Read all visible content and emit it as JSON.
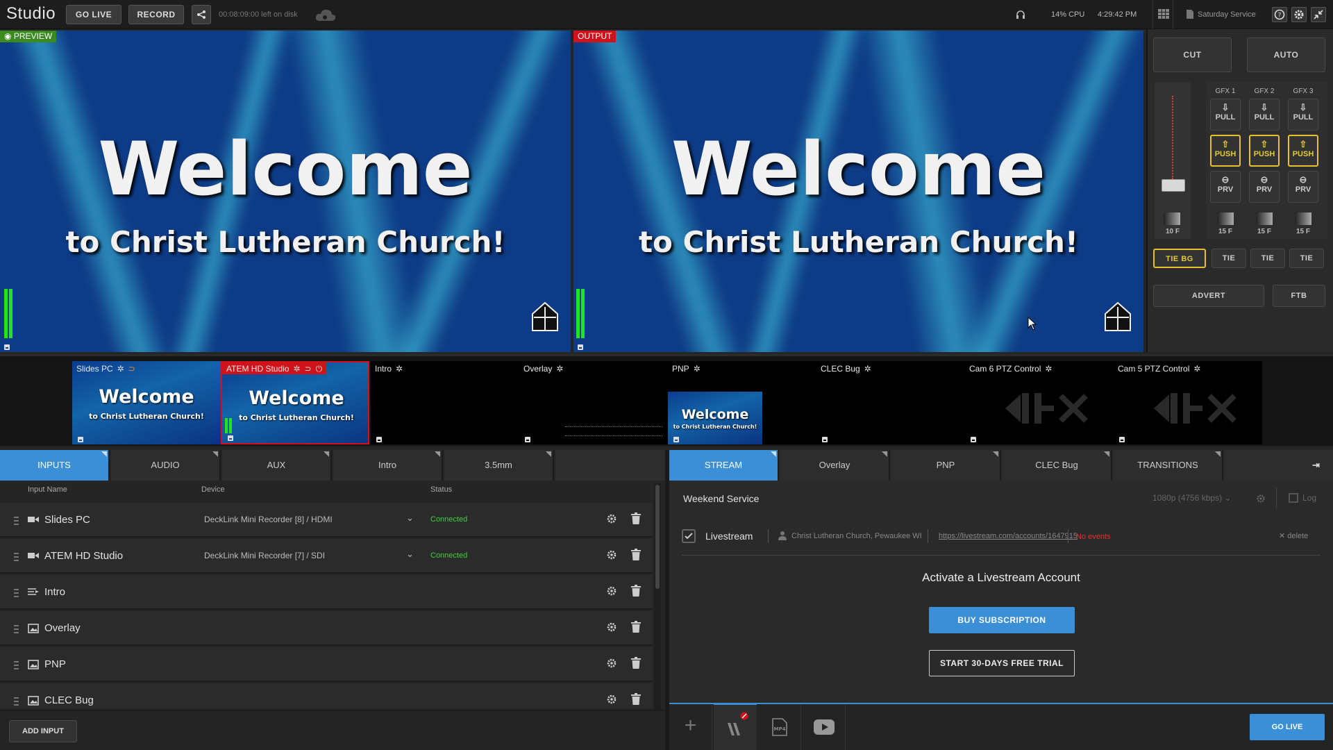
{
  "topbar": {
    "app_title": "Studio",
    "go_live": "GO LIVE",
    "record": "RECORD",
    "disk_left": "00:08:09:00 left on disk",
    "cpu": "14% CPU",
    "clock": "4:29:42 PM",
    "project": "Saturday Service"
  },
  "preview": {
    "badge": "PREVIEW",
    "line1": "Welcome",
    "line2": "to Christ Lutheran Church!",
    "audio_level": 0.55
  },
  "output": {
    "badge": "OUTPUT",
    "line1": "Welcome",
    "line2": "to Christ Lutheran Church!",
    "audio_level": 0.55
  },
  "controls": {
    "cut": "CUT",
    "auto": "AUTO",
    "gfx_headers": [
      "GFX 1",
      "GFX 2",
      "GFX 3"
    ],
    "pull": "PULL",
    "push": "PUSH",
    "prv": "PRV",
    "frames": [
      "10 F",
      "15 F",
      "15 F",
      "15 F"
    ],
    "tie_bg": "TIE BG",
    "tie": "TIE",
    "advert": "ADVERT",
    "ftb": "FTB"
  },
  "multiview": [
    {
      "label": "Slides PC",
      "colors": {
        "label_bg": ""
      }
    },
    {
      "label": "ATEM HD Studio"
    },
    {
      "label": "Intro"
    },
    {
      "label": "Overlay"
    },
    {
      "label": "PNP"
    },
    {
      "label": "CLEC Bug"
    },
    {
      "label": "Cam 6 PTZ Control"
    },
    {
      "label": "Cam 5 PTZ Control"
    }
  ],
  "thumb_text": {
    "line1": "Welcome",
    "line2": "to Christ Lutheran Church!"
  },
  "left_tabs": [
    "INPUTS",
    "AUDIO",
    "AUX",
    "Intro",
    "3.5mm"
  ],
  "columns": {
    "name": "Input Name",
    "device": "Device",
    "status": "Status"
  },
  "inputs": [
    {
      "name": "Slides PC",
      "device": "DeckLink Mini Recorder [8] / HDMI",
      "status": "Connected",
      "icon": "camera-icon"
    },
    {
      "name": "ATEM HD Studio",
      "device": "DeckLink Mini Recorder [7] / SDI",
      "status": "Connected",
      "icon": "camera-icon"
    },
    {
      "name": "Intro",
      "device": "",
      "status": "",
      "icon": "playlist-icon"
    },
    {
      "name": "Overlay",
      "device": "",
      "status": "",
      "icon": "image-icon"
    },
    {
      "name": "PNP",
      "device": "",
      "status": "",
      "icon": "image-icon"
    },
    {
      "name": "CLEC Bug",
      "device": "",
      "status": "",
      "icon": "image-icon"
    }
  ],
  "add_input": "ADD INPUT",
  "right_tabs": [
    "STREAM",
    "Overlay",
    "PNP",
    "CLEC Bug",
    "TRANSITIONS"
  ],
  "stream": {
    "title": "Weekend Service",
    "quality": "1080p (4756 kbps)",
    "log": "Log",
    "service": "Livestream",
    "account": "Christ Lutheran Church, Pewaukee WI",
    "url": "https://livestream.com/accounts/1647915",
    "events": "No events",
    "delete": "delete",
    "activate": "Activate a Livestream Account",
    "buy": "BUY SUBSCRIPTION",
    "trial": "START 30-DAYS FREE TRIAL",
    "go_live": "GO LIVE"
  },
  "colors": {
    "accent": "#3b8fd6",
    "preview_badge": "#3a8a1f",
    "output_badge": "#d0121b",
    "push_border": "#e7c22a",
    "connected": "#3bd33b",
    "no_events": "#e0342f"
  }
}
